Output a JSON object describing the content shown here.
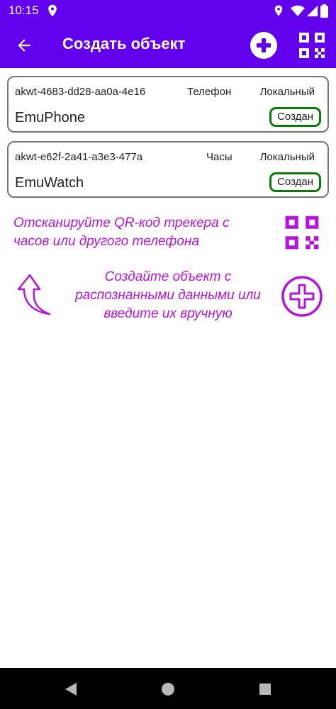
{
  "status_bar": {
    "time": "10:15",
    "icons": [
      "location-icon",
      "location-icon",
      "wifi-icon",
      "cell-signal-icon",
      "battery-icon"
    ]
  },
  "app_bar": {
    "title": "Создать объект",
    "back_icon": "arrow-left-icon",
    "add_icon": "add-circle-icon",
    "qr_icon": "qr-code-icon",
    "color": "#6200ee"
  },
  "objects": [
    {
      "id": "akwt-4683-dd28-aa0a-4e16",
      "type": "Телефон",
      "scope": "Локальный",
      "name": "EmuPhone",
      "status": "Создан"
    },
    {
      "id": "akwt-e62f-2a41-a3e3-477a",
      "type": "Часы",
      "scope": "Локальный",
      "name": "EmuWatch",
      "status": "Создан"
    }
  ],
  "hints": {
    "scan_qr": "Отсканируйте QR-код трекера с часов или другого телефона",
    "create_object": "Создайте объект с распознанными данными или введите их вручную",
    "color": "#b516d6"
  },
  "colors": {
    "status_border": "#0a7a0a",
    "card_border": "#757575"
  },
  "nav_bar": {
    "icons": [
      "back-triangle-icon",
      "home-circle-icon",
      "recents-square-icon"
    ]
  }
}
